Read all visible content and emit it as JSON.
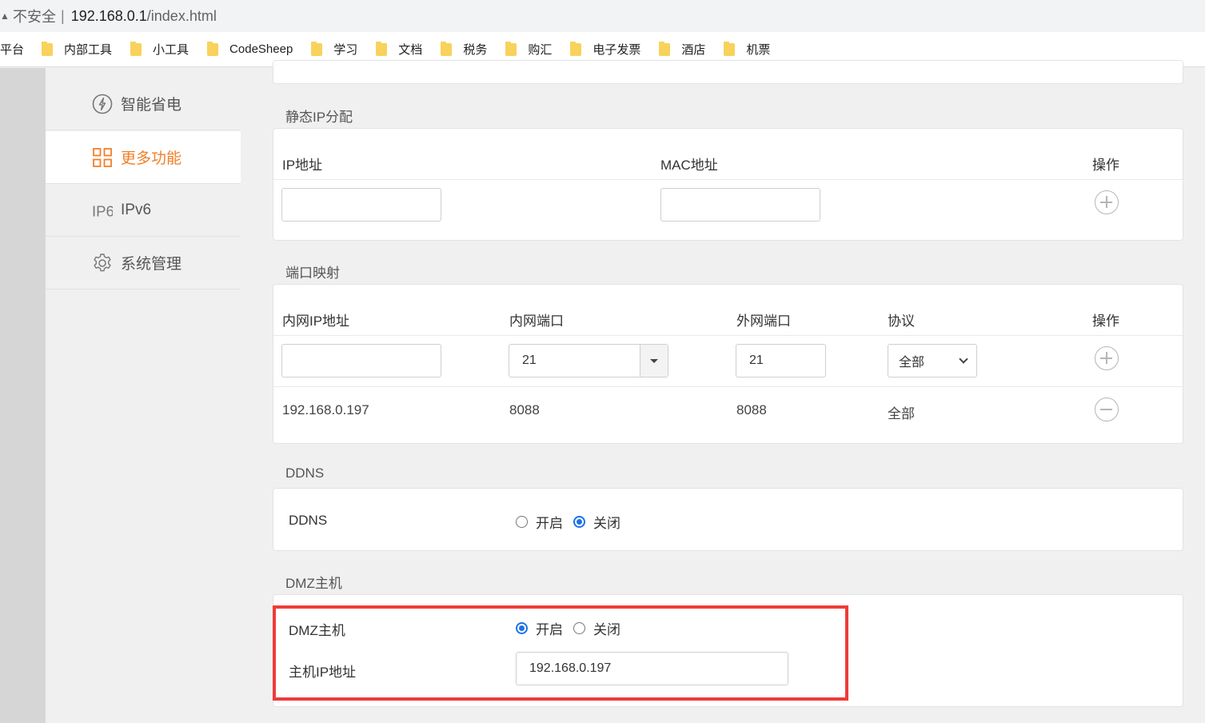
{
  "browser": {
    "insecure_label": "不安全",
    "separator": "|",
    "url_host": "192.168.0.1",
    "url_path": "/index.html",
    "bookmarks_first": "平台",
    "bookmarks": [
      "内部工具",
      "小工具",
      "CodeSheep",
      "学习",
      "文档",
      "税务",
      "购汇",
      "电子发票",
      "酒店",
      "机票"
    ]
  },
  "sidebar": {
    "items": [
      {
        "label": "智能省电",
        "icon": "power-save-icon"
      },
      {
        "label": "更多功能",
        "icon": "grid-icon",
        "active": true
      },
      {
        "label": "IPv6",
        "icon": "ipv6-icon"
      },
      {
        "label": "系统管理",
        "icon": "gear-icon"
      }
    ],
    "ipv6_glyph": "IP6"
  },
  "static_ip": {
    "title": "静态IP分配",
    "col_ip": "IP地址",
    "col_mac": "MAC地址",
    "col_op": "操作",
    "ip_value": "",
    "mac_value": ""
  },
  "port_mapping": {
    "title": "端口映射",
    "col_lan_ip": "内网IP地址",
    "col_lan_port": "内网端口",
    "col_wan_port": "外网端口",
    "col_protocol": "协议",
    "col_op": "操作",
    "input": {
      "lan_ip": "",
      "lan_port": "21",
      "wan_port": "21",
      "protocol": "全部"
    },
    "rows": [
      {
        "lan_ip": "192.168.0.197",
        "lan_port": "8088",
        "wan_port": "8088",
        "protocol": "全部"
      }
    ]
  },
  "ddns": {
    "title": "DDNS",
    "label": "DDNS",
    "opt_on": "开启",
    "opt_off": "关闭",
    "selected": "关闭"
  },
  "dmz": {
    "title": "DMZ主机",
    "label": "DMZ主机",
    "opt_on": "开启",
    "opt_off": "关闭",
    "selected": "开启",
    "host_ip_label": "主机IP地址",
    "host_ip_value": "192.168.0.197"
  },
  "colors": {
    "accent": "#f0802a",
    "highlight": "#ef3b3b",
    "radio_selected": "#1a73e8"
  }
}
